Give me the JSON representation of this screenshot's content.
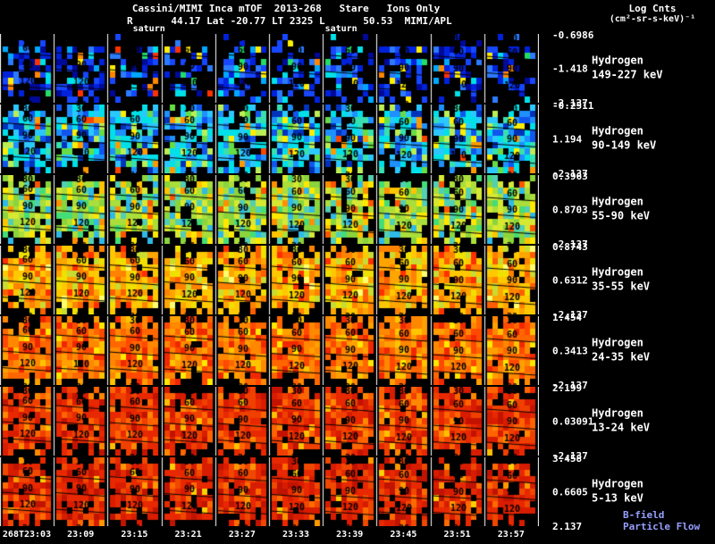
{
  "header": {
    "title": "Cassini/MIMI Inca mTOF  2013-268   Stare   Ions Only",
    "r_label": "R",
    "r_sub": "saturn",
    "mid": " 44.17 Lat -20.77 LT 2325 ",
    "l_label": "L",
    "l_sub": "saturn",
    "tail": " 50.53  MIMI/APL",
    "colorbar_title_line1": "Log Cnts",
    "colorbar_title_line2": "(cm²-sr-s-keV)⁻¹"
  },
  "footer_note": "B-field Particle Flow",
  "time_axis": {
    "labels": [
      "268T23:03",
      "23:09",
      "23:15",
      "23:21",
      "23:27",
      "23:33",
      "23:39",
      "23:45",
      "23:51",
      "23:57"
    ]
  },
  "chart_data": {
    "type": "heatmap",
    "title": "Cassini/MIMI Inca mTOF 2013-268 Stare Ions Only",
    "subtitle": "R_saturn 44.17 Lat -20.77 LT 2325 L_saturn 50.53 MIMI/APL",
    "colorbar_units": "Log Cnts (cm²-sr-s-keV)⁻¹",
    "x": [
      "268T23:03",
      "23:09",
      "23:15",
      "23:21",
      "23:27",
      "23:33",
      "23:39",
      "23:45",
      "23:51",
      "23:57"
    ],
    "frames_per_panel": 10,
    "contours": [
      {
        "label": "60",
        "y": 20
      },
      {
        "label": "90",
        "y": 38.5
      },
      {
        "label": "120",
        "y": 57
      }
    ],
    "cut_label_top": "30",
    "cut_label_bottom": "30",
    "panels": [
      {
        "species": "Hydrogen",
        "energy": "149-227 keV",
        "cbar_top": "-0.6986",
        "cbar_mid": "-1.418",
        "cbar_bottom": "-2.137",
        "range": [
          -2.137,
          -0.6986
        ],
        "top_black": 0.85,
        "top_black_rows": 2,
        "palette": [
          [
            "#000000",
            46
          ],
          [
            "#000a99",
            8
          ],
          [
            "#0022dd",
            14
          ],
          [
            "#1747ff",
            10
          ],
          [
            "#2b7bff",
            6
          ],
          [
            "#00a8ff",
            5
          ],
          [
            "#00e0e8",
            4
          ],
          [
            "#22dd66",
            2
          ],
          [
            "#ffee00",
            2
          ],
          [
            "#ff8800",
            2
          ],
          [
            "#ff3300",
            1
          ]
        ]
      },
      {
        "species": "Hydrogen",
        "energy": "90-149 keV",
        "cbar_top": "-0.2511",
        "cbar_mid": "1.194",
        "cbar_bottom": "-2.137",
        "range": [
          -2.137,
          -0.2511
        ],
        "top_black": 0.6,
        "top_black_rows": 1,
        "palette": [
          [
            "#000000",
            16
          ],
          [
            "#00e0e8",
            16
          ],
          [
            "#2bc8ff",
            14
          ],
          [
            "#1e90ff",
            12
          ],
          [
            "#1255ee",
            8
          ],
          [
            "#0033bb",
            5
          ],
          [
            "#38e0b0",
            8
          ],
          [
            "#66dd44",
            6
          ],
          [
            "#bbee55",
            4
          ],
          [
            "#ffee00",
            3
          ],
          [
            "#ff9900",
            2
          ],
          [
            "#ff4400",
            1
          ]
        ]
      },
      {
        "species": "Hydrogen",
        "energy": "55-90 keV",
        "cbar_top": "0.3963",
        "cbar_mid": "0.8703",
        "cbar_bottom": "-2.137",
        "range": [
          -2.137,
          0.3963
        ],
        "top_black": 0.55,
        "top_black_rows": 1,
        "palette": [
          [
            "#000000",
            9
          ],
          [
            "#aade3a",
            16
          ],
          [
            "#8ad43c",
            13
          ],
          [
            "#d6e832",
            13
          ],
          [
            "#52cfb4",
            9
          ],
          [
            "#2fb9e8",
            6
          ],
          [
            "#ffe800",
            8
          ],
          [
            "#ffc400",
            5
          ],
          [
            "#ff9100",
            4
          ],
          [
            "#ff5500",
            2
          ],
          [
            "#44dd77",
            5
          ]
        ]
      },
      {
        "species": "Hydrogen",
        "energy": "35-55 keV",
        "cbar_top": "0.8743",
        "cbar_mid": "0.6312",
        "cbar_bottom": "-2.137",
        "range": [
          -2.137,
          0.8743
        ],
        "top_black": 0.55,
        "top_black_rows": 1,
        "palette": [
          [
            "#000000",
            6
          ],
          [
            "#ffc800",
            18
          ],
          [
            "#ffa500",
            18
          ],
          [
            "#ff8200",
            14
          ],
          [
            "#f0e000",
            10
          ],
          [
            "#ff5e00",
            9
          ],
          [
            "#c8dc32",
            7
          ],
          [
            "#ff3000",
            4
          ],
          [
            "#ffff70",
            3
          ]
        ]
      },
      {
        "species": "Hydrogen",
        "energy": "24-35 keV",
        "cbar_top": "1.454",
        "cbar_mid": "0.3413",
        "cbar_bottom": "-2.137",
        "range": [
          -2.137,
          1.454
        ],
        "top_black": 0.55,
        "top_black_rows": 1,
        "palette": [
          [
            "#000000",
            5
          ],
          [
            "#ff8800",
            20
          ],
          [
            "#ff6600",
            18
          ],
          [
            "#ff9f00",
            12
          ],
          [
            "#ff4800",
            14
          ],
          [
            "#f02800",
            9
          ],
          [
            "#ffc400",
            7
          ],
          [
            "#ffe800",
            3
          ]
        ]
      },
      {
        "species": "Hydrogen",
        "energy": "13-24 keV",
        "cbar_top": "2.199",
        "cbar_mid": "0.03091",
        "cbar_bottom": "-2.137",
        "range": [
          -2.137,
          2.199
        ],
        "top_black": 0.55,
        "top_black_rows": 1,
        "palette": [
          [
            "#000000",
            5
          ],
          [
            "#f04000",
            20
          ],
          [
            "#e82800",
            20
          ],
          [
            "#ff6400",
            14
          ],
          [
            "#d81c00",
            12
          ],
          [
            "#ff8800",
            7
          ],
          [
            "#c41200",
            7
          ],
          [
            "#ffc000",
            3
          ]
        ]
      },
      {
        "species": "Hydrogen",
        "energy": "5-13 keV",
        "cbar_top": "3.458",
        "cbar_mid": "0.6605",
        "cbar_bottom": "2.137",
        "range": [
          -2.137,
          3.458
        ],
        "top_black": 0.65,
        "top_black_rows": 1,
        "palette": [
          [
            "#000000",
            10
          ],
          [
            "#e82800",
            22
          ],
          [
            "#d81c00",
            18
          ],
          [
            "#f04800",
            14
          ],
          [
            "#c01400",
            12
          ],
          [
            "#ff6a00",
            7
          ],
          [
            "#ff9900",
            3
          ],
          [
            "#ffd000",
            2
          ]
        ]
      }
    ]
  }
}
